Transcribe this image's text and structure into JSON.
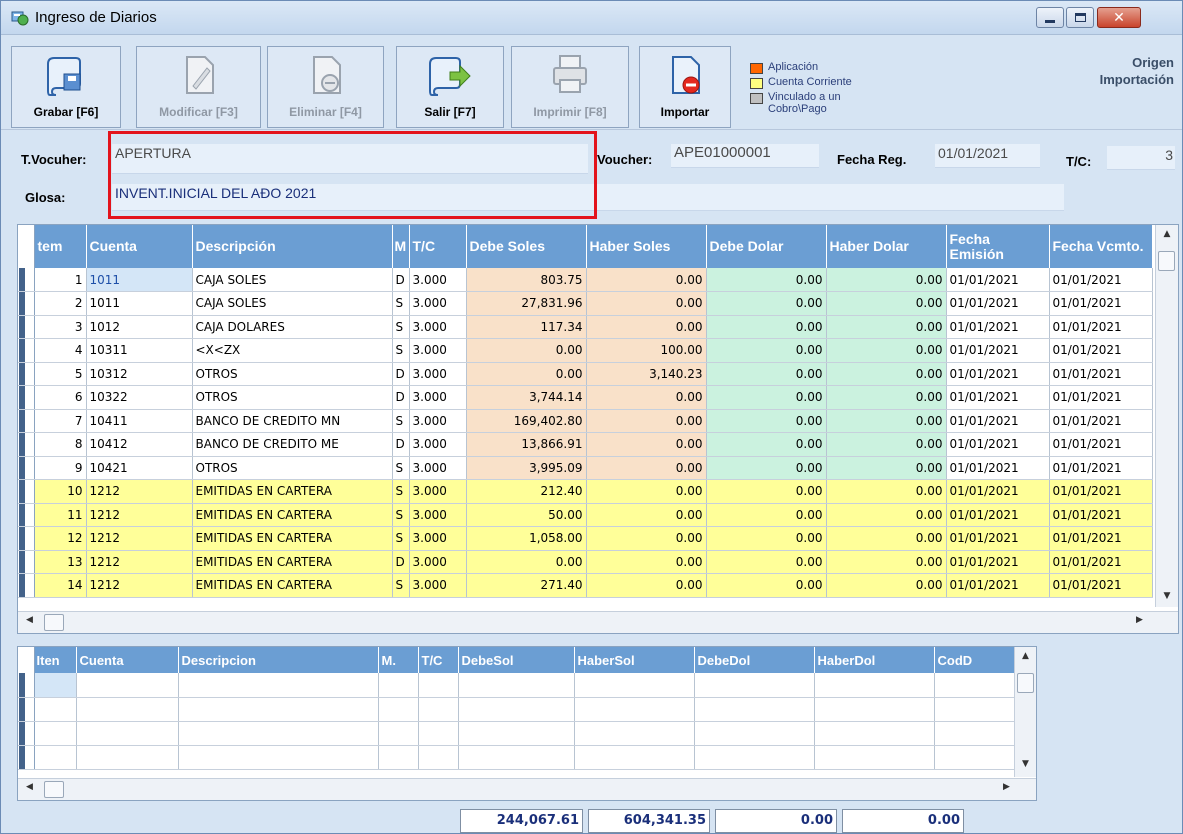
{
  "window": {
    "title": "Ingreso de Diarios"
  },
  "toolbar": {
    "buttons": [
      {
        "label": "Grabar [F6]",
        "enabled": true
      },
      {
        "label": "Modificar [F3]",
        "enabled": false
      },
      {
        "label": "Eliminar [F4]",
        "enabled": false
      },
      {
        "label": "Salir [F7]",
        "enabled": true
      },
      {
        "label": "Imprimir [F8]",
        "enabled": false
      },
      {
        "label": "Importar",
        "enabled": true
      }
    ],
    "legend": [
      {
        "label": "Aplicación",
        "color": "#ff6600"
      },
      {
        "label": "Cuenta Corriente",
        "color": "#ffff80"
      },
      {
        "label": "Vinculado a un Cobro\\Pago",
        "color": "#c0c0c0"
      }
    ],
    "origen_line1": "Origen",
    "origen_line2": "Importación"
  },
  "header": {
    "tvoucher_label": "T.Vocuher:",
    "tvoucher_value": "APERTURA",
    "voucher_label": "Voucher:",
    "voucher_value": "APE01000001",
    "fecha_label": "Fecha Reg.",
    "fecha_value": "01/01/2021",
    "tc_label": "T/C:",
    "tc_value": "3",
    "glosa_label": "Glosa:",
    "glosa_value": "INVENT.INICIAL DEL AÐO 2021"
  },
  "grid": {
    "columns": [
      "tem",
      "Cuenta",
      "Descripción",
      "M",
      "T/C",
      "Debe Soles",
      "Haber Soles",
      "Debe Dolar",
      "Haber Dolar",
      "Fecha Emisión",
      "Fecha Vcmto."
    ],
    "rows": [
      {
        "item": "1",
        "cuenta": "1011",
        "desc": "CAJA SOLES",
        "m": "D",
        "tc": "3.000",
        "debe_s": "803.75",
        "haber_s": "0.00",
        "debe_d": "0.00",
        "haber_d": "0.00",
        "f_emision": "01/01/2021",
        "f_vcmto": "01/01/2021",
        "highlight": false
      },
      {
        "item": "2",
        "cuenta": "1011",
        "desc": "CAJA SOLES",
        "m": "S",
        "tc": "3.000",
        "debe_s": "27,831.96",
        "haber_s": "0.00",
        "debe_d": "0.00",
        "haber_d": "0.00",
        "f_emision": "01/01/2021",
        "f_vcmto": "01/01/2021",
        "highlight": false
      },
      {
        "item": "3",
        "cuenta": "1012",
        "desc": "CAJA DOLARES",
        "m": "S",
        "tc": "3.000",
        "debe_s": "117.34",
        "haber_s": "0.00",
        "debe_d": "0.00",
        "haber_d": "0.00",
        "f_emision": "01/01/2021",
        "f_vcmto": "01/01/2021",
        "highlight": false
      },
      {
        "item": "4",
        "cuenta": "10311",
        "desc": "<X<ZX",
        "m": "S",
        "tc": "3.000",
        "debe_s": "0.00",
        "haber_s": "100.00",
        "debe_d": "0.00",
        "haber_d": "0.00",
        "f_emision": "01/01/2021",
        "f_vcmto": "01/01/2021",
        "highlight": false
      },
      {
        "item": "5",
        "cuenta": "10312",
        "desc": "OTROS",
        "m": "D",
        "tc": "3.000",
        "debe_s": "0.00",
        "haber_s": "3,140.23",
        "debe_d": "0.00",
        "haber_d": "0.00",
        "f_emision": "01/01/2021",
        "f_vcmto": "01/01/2021",
        "highlight": false
      },
      {
        "item": "6",
        "cuenta": "10322",
        "desc": "OTROS",
        "m": "D",
        "tc": "3.000",
        "debe_s": "3,744.14",
        "haber_s": "0.00",
        "debe_d": "0.00",
        "haber_d": "0.00",
        "f_emision": "01/01/2021",
        "f_vcmto": "01/01/2021",
        "highlight": false
      },
      {
        "item": "7",
        "cuenta": "10411",
        "desc": "BANCO DE CREDITO MN",
        "m": "S",
        "tc": "3.000",
        "debe_s": "169,402.80",
        "haber_s": "0.00",
        "debe_d": "0.00",
        "haber_d": "0.00",
        "f_emision": "01/01/2021",
        "f_vcmto": "01/01/2021",
        "highlight": false
      },
      {
        "item": "8",
        "cuenta": "10412",
        "desc": "BANCO DE CREDITO ME",
        "m": "D",
        "tc": "3.000",
        "debe_s": "13,866.91",
        "haber_s": "0.00",
        "debe_d": "0.00",
        "haber_d": "0.00",
        "f_emision": "01/01/2021",
        "f_vcmto": "01/01/2021",
        "highlight": false
      },
      {
        "item": "9",
        "cuenta": "10421",
        "desc": "OTROS",
        "m": "S",
        "tc": "3.000",
        "debe_s": "3,995.09",
        "haber_s": "0.00",
        "debe_d": "0.00",
        "haber_d": "0.00",
        "f_emision": "01/01/2021",
        "f_vcmto": "01/01/2021",
        "highlight": false
      },
      {
        "item": "10",
        "cuenta": "1212",
        "desc": "EMITIDAS EN CARTERA",
        "m": "S",
        "tc": "3.000",
        "debe_s": "212.40",
        "haber_s": "0.00",
        "debe_d": "0.00",
        "haber_d": "0.00",
        "f_emision": "01/01/2021",
        "f_vcmto": "01/01/2021",
        "highlight": true
      },
      {
        "item": "11",
        "cuenta": "1212",
        "desc": "EMITIDAS EN CARTERA",
        "m": "S",
        "tc": "3.000",
        "debe_s": "50.00",
        "haber_s": "0.00",
        "debe_d": "0.00",
        "haber_d": "0.00",
        "f_emision": "01/01/2021",
        "f_vcmto": "01/01/2021",
        "highlight": true
      },
      {
        "item": "12",
        "cuenta": "1212",
        "desc": "EMITIDAS EN CARTERA",
        "m": "S",
        "tc": "3.000",
        "debe_s": "1,058.00",
        "haber_s": "0.00",
        "debe_d": "0.00",
        "haber_d": "0.00",
        "f_emision": "01/01/2021",
        "f_vcmto": "01/01/2021",
        "highlight": true
      },
      {
        "item": "13",
        "cuenta": "1212",
        "desc": "EMITIDAS EN CARTERA",
        "m": "D",
        "tc": "3.000",
        "debe_s": "0.00",
        "haber_s": "0.00",
        "debe_d": "0.00",
        "haber_d": "0.00",
        "f_emision": "01/01/2021",
        "f_vcmto": "01/01/2021",
        "highlight": true
      },
      {
        "item": "14",
        "cuenta": "1212",
        "desc": "EMITIDAS EN CARTERA",
        "m": "S",
        "tc": "3.000",
        "debe_s": "271.40",
        "haber_s": "0.00",
        "debe_d": "0.00",
        "haber_d": "0.00",
        "f_emision": "01/01/2021",
        "f_vcmto": "01/01/2021",
        "highlight": true
      }
    ]
  },
  "grid2": {
    "columns": [
      "Iten",
      "Cuenta",
      "Descripcion",
      "M.",
      "T/C",
      "DebeSol",
      "HaberSol",
      "DebeDol",
      "HaberDol",
      "CodD"
    ]
  },
  "totals": {
    "debe_soles": "244,067.61",
    "haber_soles": "604,341.35",
    "debe_dolar": "0.00",
    "haber_dolar": "0.00"
  },
  "colors": {
    "header_blue": "#6b9ed3",
    "peach": "#f9e1c9",
    "mint": "#cbf2df",
    "highlight_yellow": "#ffff99",
    "red_frame": "#e3131b"
  }
}
